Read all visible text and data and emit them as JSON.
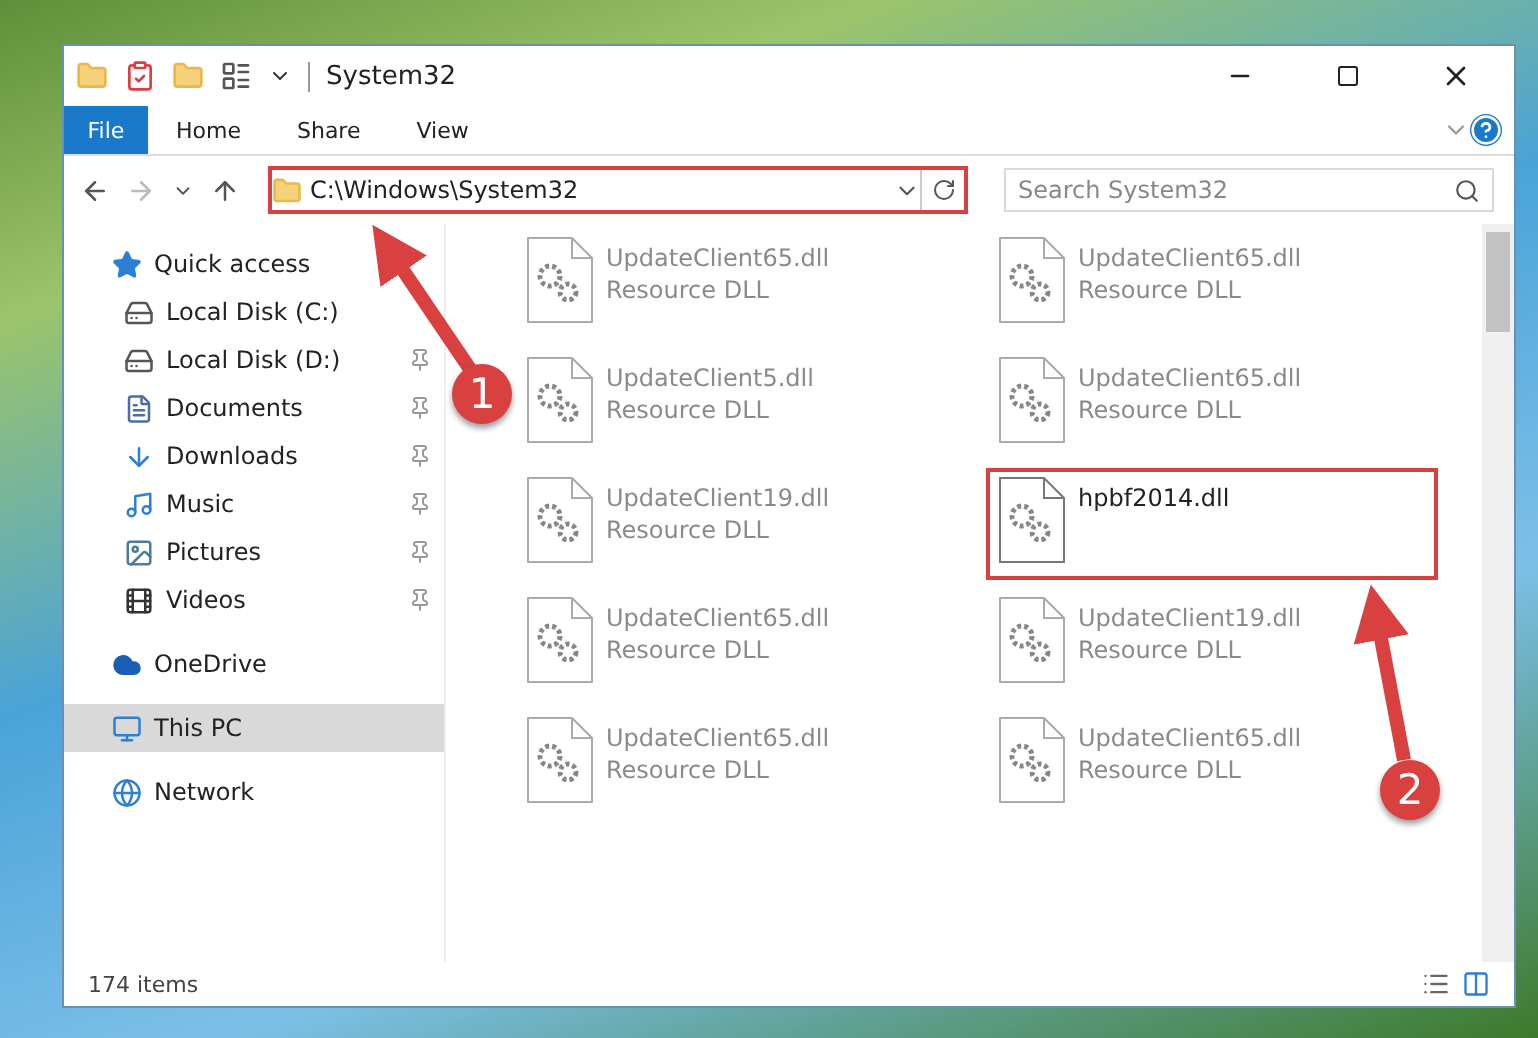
{
  "window": {
    "title": "System32"
  },
  "ribbon": {
    "file_tab": "File",
    "tabs": [
      {
        "label": "Home"
      },
      {
        "label": "Share"
      },
      {
        "label": "View"
      }
    ]
  },
  "address": {
    "value": "C:\\Windows\\System32",
    "highlighted": true
  },
  "search": {
    "placeholder": "Search System32"
  },
  "sidebar": {
    "items": [
      {
        "label": "Quick access",
        "kind": "star",
        "selected": false,
        "children": [
          {
            "label": "Local Disk (C:)",
            "kind": "system-drive",
            "pinned": false,
            "selected": false
          },
          {
            "label": "Local Disk (D:)",
            "kind": "drive",
            "pinned": true,
            "selected": false
          },
          {
            "label": "Documents",
            "kind": "documents",
            "pinned": true,
            "selected": false
          },
          {
            "label": "Downloads",
            "kind": "downloads",
            "pinned": true,
            "selected": false
          },
          {
            "label": "Music",
            "kind": "music",
            "pinned": true,
            "selected": false
          },
          {
            "label": "Pictures",
            "kind": "pictures",
            "pinned": true,
            "selected": false
          },
          {
            "label": "Videos",
            "kind": "videos",
            "pinned": true,
            "selected": false
          }
        ]
      },
      {
        "label": "OneDrive",
        "kind": "cloud",
        "selected": false
      },
      {
        "label": "This PC",
        "kind": "computer",
        "selected": true
      },
      {
        "label": "Network",
        "kind": "network",
        "selected": false
      }
    ]
  },
  "files": [
    {
      "name": "UpdateClient65.dll",
      "description": "Resource DLL",
      "blurred": true,
      "highlighted": false
    },
    {
      "name": "UpdateClient65.dll",
      "description": "Resource DLL",
      "blurred": true,
      "highlighted": false
    },
    {
      "name": "UpdateClient5.dll",
      "description": "Resource DLL",
      "blurred": true,
      "highlighted": false
    },
    {
      "name": "UpdateClient65.dll",
      "description": "Resource DLL",
      "blurred": true,
      "highlighted": false
    },
    {
      "name": "UpdateClient19.dll",
      "description": "Resource DLL",
      "blurred": true,
      "highlighted": false
    },
    {
      "name": "hpbf2014.dll",
      "blurred": false,
      "highlighted": true
    },
    {
      "name": "UpdateClient65.dll",
      "description": "Resource DLL",
      "blurred": true,
      "highlighted": false
    },
    {
      "name": "UpdateClient19.dll",
      "description": "Resource DLL",
      "blurred": true,
      "highlighted": false
    },
    {
      "name": "UpdateClient65.dll",
      "description": "Resource DLL",
      "blurred": true,
      "highlighted": false
    },
    {
      "name": "UpdateClient65.dll",
      "description": "Resource DLL",
      "blurred": true,
      "highlighted": false
    }
  ],
  "status_bar": {
    "count": "174 items"
  },
  "annotations": [
    {
      "number": "1"
    },
    {
      "number": "2"
    }
  ]
}
